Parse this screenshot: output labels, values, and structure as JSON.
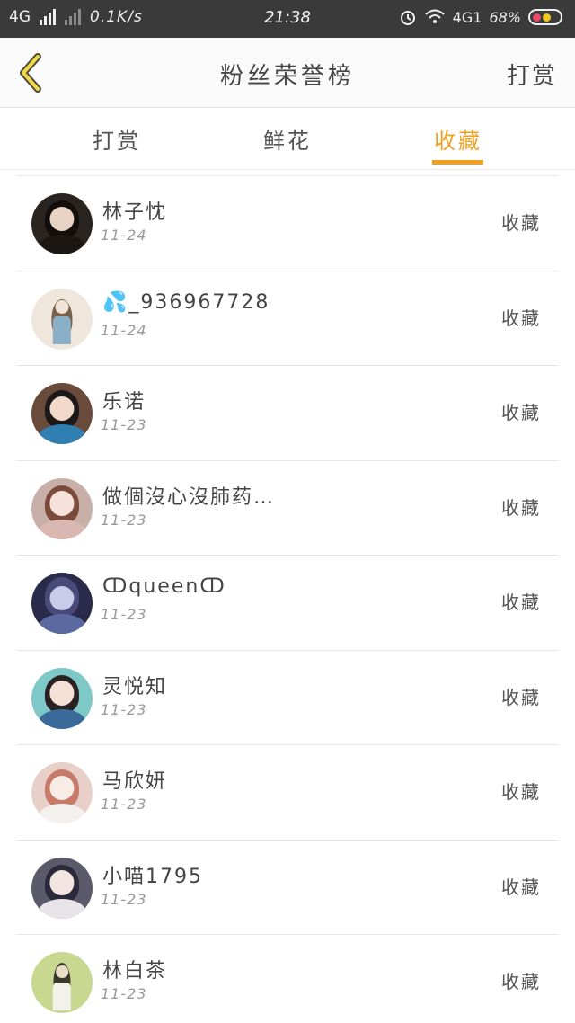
{
  "status_bar": {
    "network": "4G",
    "speed": "0.1K/s",
    "time": "21:38",
    "network_right": "4G1",
    "battery": "68%"
  },
  "nav": {
    "title": "粉丝荣誉榜",
    "action": "打赏",
    "back_icon": "chevron-left-icon"
  },
  "tabs": [
    {
      "label": "打赏",
      "active": false
    },
    {
      "label": "鲜花",
      "active": false
    },
    {
      "label": "收藏",
      "active": true
    }
  ],
  "accent_color": "#f0a020",
  "list": [
    {
      "name": "林子忱",
      "date": "11-24",
      "action": "收藏"
    },
    {
      "name": "💦_936967728",
      "date": "11-24",
      "action": "收藏"
    },
    {
      "name": "乐诺",
      "date": "11-23",
      "action": "收藏"
    },
    {
      "name": "做個沒心沒肺药…",
      "date": "11-23",
      "action": "收藏"
    },
    {
      "name": "ↀqueenↀ",
      "date": "11-23",
      "action": "收藏"
    },
    {
      "name": "灵悦知",
      "date": "11-23",
      "action": "收藏"
    },
    {
      "name": "马欣妍",
      "date": "11-23",
      "action": "收藏"
    },
    {
      "name": "小喵1795",
      "date": "11-23",
      "action": "收藏"
    },
    {
      "name": "林白茶",
      "date": "11-23",
      "action": "收藏"
    }
  ]
}
